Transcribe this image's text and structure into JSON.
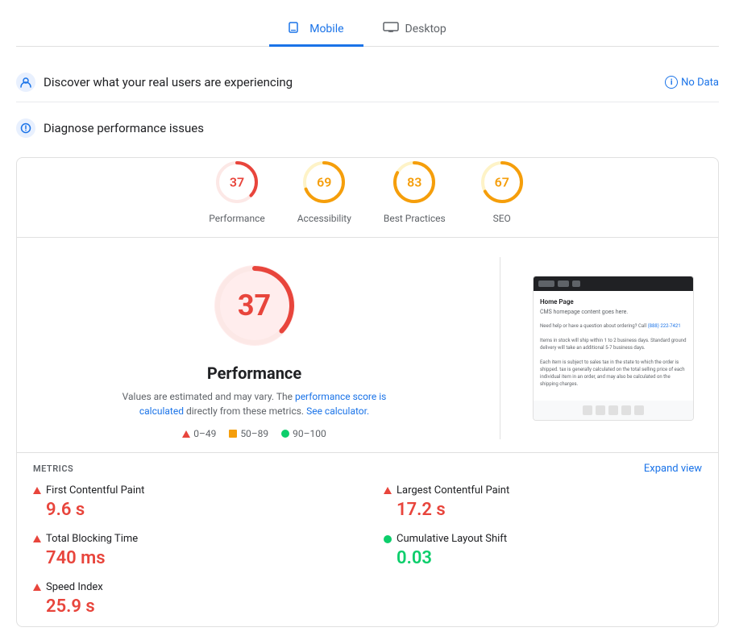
{
  "tabs": [
    {
      "id": "mobile",
      "label": "Mobile",
      "active": true
    },
    {
      "id": "desktop",
      "label": "Desktop",
      "active": false
    }
  ],
  "real_users": {
    "title": "Discover what your real users are experiencing",
    "no_data_label": "No Data"
  },
  "diagnose": {
    "title": "Diagnose performance issues"
  },
  "scores": [
    {
      "id": "performance",
      "value": "37",
      "label": "Performance",
      "color": "#e8453c",
      "bg": "#fce8e6",
      "strokeColor": "#e8453c",
      "radius": 24,
      "circumference": 150.8,
      "pct": 0.37
    },
    {
      "id": "accessibility",
      "value": "69",
      "label": "Accessibility",
      "color": "#f59e0b",
      "bg": "#fef3c7",
      "strokeColor": "#f59e0b",
      "radius": 24,
      "circumference": 150.8,
      "pct": 0.69
    },
    {
      "id": "best-practices",
      "value": "83",
      "label": "Best Practices",
      "color": "#f59e0b",
      "bg": "#fef3c7",
      "strokeColor": "#f59e0b",
      "radius": 24,
      "circumference": 150.8,
      "pct": 0.83
    },
    {
      "id": "seo",
      "value": "67",
      "label": "SEO",
      "color": "#f59e0b",
      "bg": "#fef3c7",
      "strokeColor": "#f59e0b",
      "radius": 24,
      "circumference": 150.8,
      "pct": 0.67
    }
  ],
  "performance_detail": {
    "score": "37",
    "title": "Performance",
    "description_start": "Values are estimated and may vary. The",
    "link1_text": "performance score is calculated",
    "description_middle": "directly from these metrics.",
    "link2_text": "See calculator.",
    "legend": [
      {
        "type": "triangle",
        "range": "0–49"
      },
      {
        "type": "square",
        "range": "50–89"
      },
      {
        "type": "circle",
        "range": "90–100"
      }
    ]
  },
  "metrics": {
    "title": "METRICS",
    "expand_label": "Expand view",
    "items": [
      {
        "id": "fcp",
        "label": "First Contentful Paint",
        "value": "9.6 s",
        "status": "red"
      },
      {
        "id": "lcp",
        "label": "Largest Contentful Paint",
        "value": "17.2 s",
        "status": "red"
      },
      {
        "id": "tbt",
        "label": "Total Blocking Time",
        "value": "740 ms",
        "status": "red"
      },
      {
        "id": "cls",
        "label": "Cumulative Layout Shift",
        "value": "0.03",
        "status": "green"
      },
      {
        "id": "si",
        "label": "Speed Index",
        "value": "25.9 s",
        "status": "red"
      }
    ]
  },
  "preview": {
    "heading": "Home Page",
    "subheading": "CMS homepage content goes here.",
    "content": "Need help or have a question about ordering? Call (888) 222-7421\n\nItems in stock will ship within 1 to 2 business days. Standard ground delivery will take an additional 5-7 business days.\n\nEach item is subject to sales tax in the state to which the order is shipped. tax is generally calculated on the total selling price of each individual item in an order, and may also be calculated on the shipping charges."
  }
}
